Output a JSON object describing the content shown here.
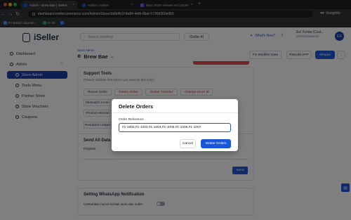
{
  "browser": {
    "tabs": [
      {
        "label": "Admin - Brew Bae | iSeller",
        "active": true
      },
      {
        "label": "Admin | iSeller",
        "active": false
      },
      {
        "label": "Best JSON Viewer and JSON",
        "active": false
      }
    ],
    "url": "dashboard.isellercommerce.com/Admin/Store/cb6b4b1f-8a84-4efb-8baf-6736d360e9b5",
    "incognito_label": "Incognito",
    "bookmarks": [
      "PJ Berezi Jaya Be...",
      "AI 10",
      ""
    ]
  },
  "app": {
    "logo_text": "iSeller",
    "search_placeholder": "Search anything",
    "ai_button": "iSeller AI",
    "whats_new": "What's New?",
    "user_name": "Evi Yunita (Cust...",
    "user_org": "Interstit Solutions",
    "avatar_initials": "ES"
  },
  "sidebar": {
    "items": [
      {
        "label": "Dashboard",
        "selected": false
      },
      {
        "label": "Admin",
        "selected": false
      },
      {
        "label": "Store Admin",
        "selected": true
      },
      {
        "label": "Tools Menu",
        "selected": false
      },
      {
        "label": "Partner Store",
        "selected": false
      },
      {
        "label": "Store Vouchers",
        "selected": false
      },
      {
        "label": "Coupons",
        "selected": false
      }
    ]
  },
  "main": {
    "breadcrumb": "Store Admin",
    "store_name": "Brew Bae",
    "top_buttons": {
      "fix_modifier": "Fix Modifier Data",
      "rebuild_hpp": "Rebuild HPP",
      "save": "Simpan"
    },
    "support_tools": {
      "title": "Support Tools",
      "subtitle": "(Please Validate first before you execute this tool!)",
      "buttons": [
        "Revive Order",
        "Delete Order",
        "Delete Transfer",
        "Change Store Id",
        "Mismatch Inven",
        "Product Mismat",
        "Resubmit Ledger"
      ]
    },
    "send_all_data": {
      "title": "Send All Data",
      "register_label": "Register",
      "send_button": "Send"
    },
    "whatsapp": {
      "title": "Setting WhatsApp Notification",
      "toggle_label": "Cantumkan nomor kontak store dan outlet"
    }
  },
  "modal": {
    "title": "Delete Orders",
    "field_label": "Order Reference",
    "field_value": "#1-1002,#1-1003,#1-1004,#1-1005,#1-1006,#1-1007",
    "cancel_label": "Cancel",
    "confirm_label": "Delete Orders"
  },
  "colors": {
    "primary": "#1a56db",
    "sidebar_selected": "#1a3fa8",
    "danger": "#d92d20"
  }
}
